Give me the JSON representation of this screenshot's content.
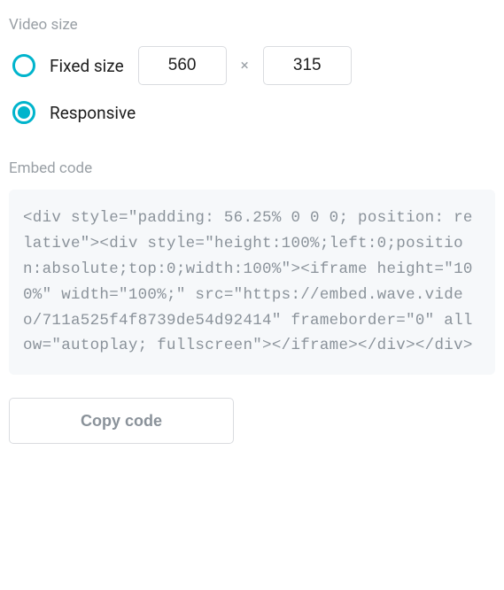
{
  "video_size": {
    "section_label": "Video size",
    "fixed": {
      "label": "Fixed size",
      "width": "560",
      "separator": "×",
      "height": "315",
      "selected": false
    },
    "responsive": {
      "label": "Responsive",
      "selected": true
    }
  },
  "embed": {
    "section_label": "Embed code",
    "code": "<div style=\"padding: 56.25% 0 0 0; position: relative\"><div style=\"height:100%;left:0;position:absolute;top:0;width:100%\"><iframe height=\"100%\" width=\"100%;\" src=\"https://embed.wave.video/711a525f4f8739de54d92414\" frameborder=\"0\" allow=\"autoplay; fullscreen\"></iframe></div></div>"
  },
  "copy_button": "Copy code"
}
